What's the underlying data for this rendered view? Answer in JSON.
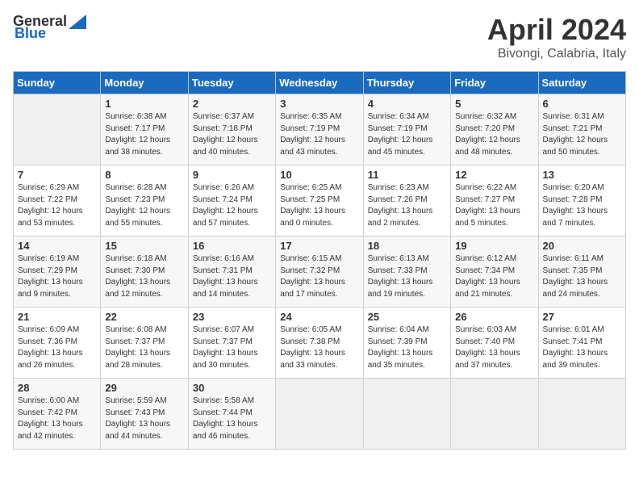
{
  "header": {
    "logo_general": "General",
    "logo_blue": "Blue",
    "month_title": "April 2024",
    "location": "Bivongi, Calabria, Italy"
  },
  "days_of_week": [
    "Sunday",
    "Monday",
    "Tuesday",
    "Wednesday",
    "Thursday",
    "Friday",
    "Saturday"
  ],
  "weeks": [
    [
      {
        "day": "",
        "sunrise": "",
        "sunset": "",
        "daylight": ""
      },
      {
        "day": "1",
        "sunrise": "Sunrise: 6:38 AM",
        "sunset": "Sunset: 7:17 PM",
        "daylight": "Daylight: 12 hours and 38 minutes."
      },
      {
        "day": "2",
        "sunrise": "Sunrise: 6:37 AM",
        "sunset": "Sunset: 7:18 PM",
        "daylight": "Daylight: 12 hours and 40 minutes."
      },
      {
        "day": "3",
        "sunrise": "Sunrise: 6:35 AM",
        "sunset": "Sunset: 7:19 PM",
        "daylight": "Daylight: 12 hours and 43 minutes."
      },
      {
        "day": "4",
        "sunrise": "Sunrise: 6:34 AM",
        "sunset": "Sunset: 7:19 PM",
        "daylight": "Daylight: 12 hours and 45 minutes."
      },
      {
        "day": "5",
        "sunrise": "Sunrise: 6:32 AM",
        "sunset": "Sunset: 7:20 PM",
        "daylight": "Daylight: 12 hours and 48 minutes."
      },
      {
        "day": "6",
        "sunrise": "Sunrise: 6:31 AM",
        "sunset": "Sunset: 7:21 PM",
        "daylight": "Daylight: 12 hours and 50 minutes."
      }
    ],
    [
      {
        "day": "7",
        "sunrise": "Sunrise: 6:29 AM",
        "sunset": "Sunset: 7:22 PM",
        "daylight": "Daylight: 12 hours and 53 minutes."
      },
      {
        "day": "8",
        "sunrise": "Sunrise: 6:28 AM",
        "sunset": "Sunset: 7:23 PM",
        "daylight": "Daylight: 12 hours and 55 minutes."
      },
      {
        "day": "9",
        "sunrise": "Sunrise: 6:26 AM",
        "sunset": "Sunset: 7:24 PM",
        "daylight": "Daylight: 12 hours and 57 minutes."
      },
      {
        "day": "10",
        "sunrise": "Sunrise: 6:25 AM",
        "sunset": "Sunset: 7:25 PM",
        "daylight": "Daylight: 13 hours and 0 minutes."
      },
      {
        "day": "11",
        "sunrise": "Sunrise: 6:23 AM",
        "sunset": "Sunset: 7:26 PM",
        "daylight": "Daylight: 13 hours and 2 minutes."
      },
      {
        "day": "12",
        "sunrise": "Sunrise: 6:22 AM",
        "sunset": "Sunset: 7:27 PM",
        "daylight": "Daylight: 13 hours and 5 minutes."
      },
      {
        "day": "13",
        "sunrise": "Sunrise: 6:20 AM",
        "sunset": "Sunset: 7:28 PM",
        "daylight": "Daylight: 13 hours and 7 minutes."
      }
    ],
    [
      {
        "day": "14",
        "sunrise": "Sunrise: 6:19 AM",
        "sunset": "Sunset: 7:29 PM",
        "daylight": "Daylight: 13 hours and 9 minutes."
      },
      {
        "day": "15",
        "sunrise": "Sunrise: 6:18 AM",
        "sunset": "Sunset: 7:30 PM",
        "daylight": "Daylight: 13 hours and 12 minutes."
      },
      {
        "day": "16",
        "sunrise": "Sunrise: 6:16 AM",
        "sunset": "Sunset: 7:31 PM",
        "daylight": "Daylight: 13 hours and 14 minutes."
      },
      {
        "day": "17",
        "sunrise": "Sunrise: 6:15 AM",
        "sunset": "Sunset: 7:32 PM",
        "daylight": "Daylight: 13 hours and 17 minutes."
      },
      {
        "day": "18",
        "sunrise": "Sunrise: 6:13 AM",
        "sunset": "Sunset: 7:33 PM",
        "daylight": "Daylight: 13 hours and 19 minutes."
      },
      {
        "day": "19",
        "sunrise": "Sunrise: 6:12 AM",
        "sunset": "Sunset: 7:34 PM",
        "daylight": "Daylight: 13 hours and 21 minutes."
      },
      {
        "day": "20",
        "sunrise": "Sunrise: 6:11 AM",
        "sunset": "Sunset: 7:35 PM",
        "daylight": "Daylight: 13 hours and 24 minutes."
      }
    ],
    [
      {
        "day": "21",
        "sunrise": "Sunrise: 6:09 AM",
        "sunset": "Sunset: 7:36 PM",
        "daylight": "Daylight: 13 hours and 26 minutes."
      },
      {
        "day": "22",
        "sunrise": "Sunrise: 6:08 AM",
        "sunset": "Sunset: 7:37 PM",
        "daylight": "Daylight: 13 hours and 28 minutes."
      },
      {
        "day": "23",
        "sunrise": "Sunrise: 6:07 AM",
        "sunset": "Sunset: 7:37 PM",
        "daylight": "Daylight: 13 hours and 30 minutes."
      },
      {
        "day": "24",
        "sunrise": "Sunrise: 6:05 AM",
        "sunset": "Sunset: 7:38 PM",
        "daylight": "Daylight: 13 hours and 33 minutes."
      },
      {
        "day": "25",
        "sunrise": "Sunrise: 6:04 AM",
        "sunset": "Sunset: 7:39 PM",
        "daylight": "Daylight: 13 hours and 35 minutes."
      },
      {
        "day": "26",
        "sunrise": "Sunrise: 6:03 AM",
        "sunset": "Sunset: 7:40 PM",
        "daylight": "Daylight: 13 hours and 37 minutes."
      },
      {
        "day": "27",
        "sunrise": "Sunrise: 6:01 AM",
        "sunset": "Sunset: 7:41 PM",
        "daylight": "Daylight: 13 hours and 39 minutes."
      }
    ],
    [
      {
        "day": "28",
        "sunrise": "Sunrise: 6:00 AM",
        "sunset": "Sunset: 7:42 PM",
        "daylight": "Daylight: 13 hours and 42 minutes."
      },
      {
        "day": "29",
        "sunrise": "Sunrise: 5:59 AM",
        "sunset": "Sunset: 7:43 PM",
        "daylight": "Daylight: 13 hours and 44 minutes."
      },
      {
        "day": "30",
        "sunrise": "Sunrise: 5:58 AM",
        "sunset": "Sunset: 7:44 PM",
        "daylight": "Daylight: 13 hours and 46 minutes."
      },
      {
        "day": "",
        "sunrise": "",
        "sunset": "",
        "daylight": ""
      },
      {
        "day": "",
        "sunrise": "",
        "sunset": "",
        "daylight": ""
      },
      {
        "day": "",
        "sunrise": "",
        "sunset": "",
        "daylight": ""
      },
      {
        "day": "",
        "sunrise": "",
        "sunset": "",
        "daylight": ""
      }
    ]
  ]
}
